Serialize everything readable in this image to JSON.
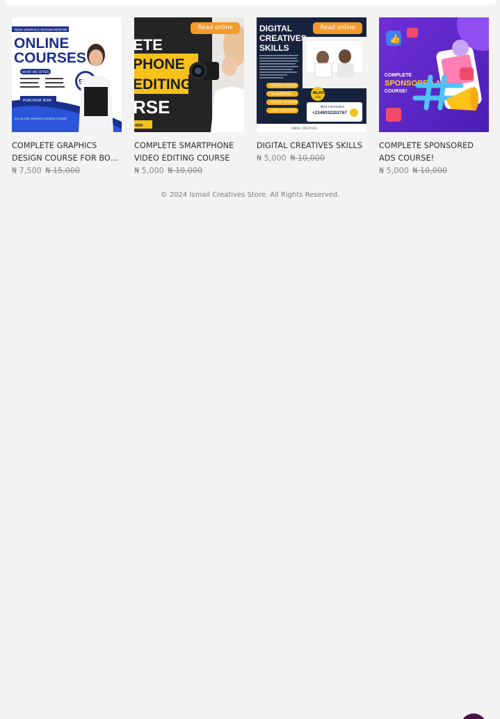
{
  "products": [
    {
      "title": "COMPLETE GRAPHICS DESIGN COURSE FOR BOTH ANDROID AND DESKTOP",
      "price": "₦ 7,500",
      "old_price": "₦ 15,000",
      "badge": "",
      "image": {
        "kicker": "YOUR GRAPHICS DESIGN MENTOR",
        "heading_1": "ONLINE",
        "heading_2": "COURSES",
        "tag": "WHAT WE OFFER",
        "discount": "50%",
        "cta": "PURCHASE NOW",
        "note": "ALL IN ONE GRAPHICS DESIGN COURSE"
      }
    },
    {
      "title": "COMPLETE SMARTPHONE VIDEO EDITING COURSE",
      "price": "₦ 5,000",
      "old_price": "₦ 10,000",
      "badge": "Read online",
      "image": {
        "line_1": "ETE",
        "line_2": "PHONE",
        "line_3": "EDITING",
        "line_4": "RSE",
        "strip": "WER"
      }
    },
    {
      "title": "DIGITAL CREATIVES SKILLS",
      "price": "₦ 5,000",
      "old_price": "₦ 10,000",
      "badge": "Read online",
      "image": {
        "line_1": "DIGITAL",
        "line_2": "CREATIVES",
        "line_3": "SKILLS",
        "items": [
          "GRAPHICS DESIGN",
          "3D ANIMATION",
          "MOTION GRAPHICS",
          "VIDEO CREATIONS"
        ],
        "price_tag": "₦5,000",
        "price_note": "only",
        "info": "More Information",
        "phone": "+2349032202767",
        "footer": "ISMAIL CREATIVES"
      }
    },
    {
      "title": "COMPLETE SPONSORED ADS COURSE!",
      "price": "₦ 5,000",
      "old_price": "₦ 10,000",
      "badge": "",
      "image": {
        "line_1": "COMPLETE",
        "line_2": "SPONSORED ADS",
        "line_3": "COURSE!"
      }
    }
  ],
  "footer": {
    "copyright": "© 2024 Ismail Creatives Store. All Rights Reserved."
  },
  "colors": {
    "background": "#f3f3f4",
    "badge": "#f39a2b",
    "price_text": "#8a8a8a",
    "chat_button": "#4a1242"
  },
  "icons": {
    "chat_button": "chat-bubble-icon"
  }
}
